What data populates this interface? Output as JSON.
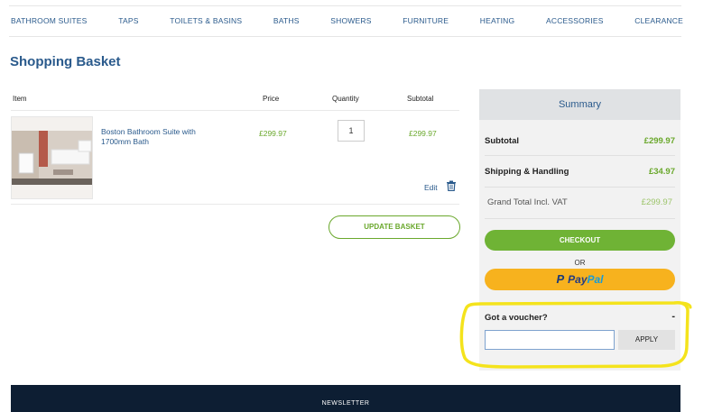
{
  "nav": {
    "items": [
      "BATHROOM SUITES",
      "TAPS",
      "TOILETS & BASINS",
      "BATHS",
      "SHOWERS",
      "FURNITURE",
      "HEATING",
      "ACCESSORIES",
      "CLEARANCE"
    ]
  },
  "page": {
    "title": "Shopping Basket"
  },
  "table": {
    "headers": {
      "item": "Item",
      "price": "Price",
      "quantity": "Quantity",
      "subtotal": "Subtotal"
    },
    "rows": [
      {
        "name": "Boston Bathroom Suite with 1700mm Bath",
        "price": "£299.97",
        "quantity": "1",
        "subtotal": "£299.97",
        "edit": "Edit",
        "delete_icon": "trash-icon"
      }
    ],
    "update_label": "UPDATE BASKET"
  },
  "summary": {
    "title": "Summary",
    "subtotal_label": "Subtotal",
    "subtotal_value": "£299.97",
    "shipping_label": "Shipping & Handling",
    "shipping_value": "£34.97",
    "grand_total_label": "Grand Total Incl. VAT",
    "grand_total_value": "£299.97",
    "checkout_label": "CHECKOUT",
    "or_label": "OR",
    "paypal_label_1": "Pay",
    "paypal_label_2": "Pal",
    "paypal_icon_letter": "P",
    "voucher_label": "Got a voucher?",
    "voucher_toggle": "-",
    "voucher_input_value": "",
    "apply_label": "APPLY"
  },
  "footer": {
    "text": "NEWSLETTER"
  },
  "colors": {
    "brand_blue": "#2a5a8c",
    "accent_green": "#6fb335",
    "paypal_yellow": "#f7b21e",
    "highlight_yellow": "#f4e31c",
    "footer_navy": "#0d1e33"
  }
}
